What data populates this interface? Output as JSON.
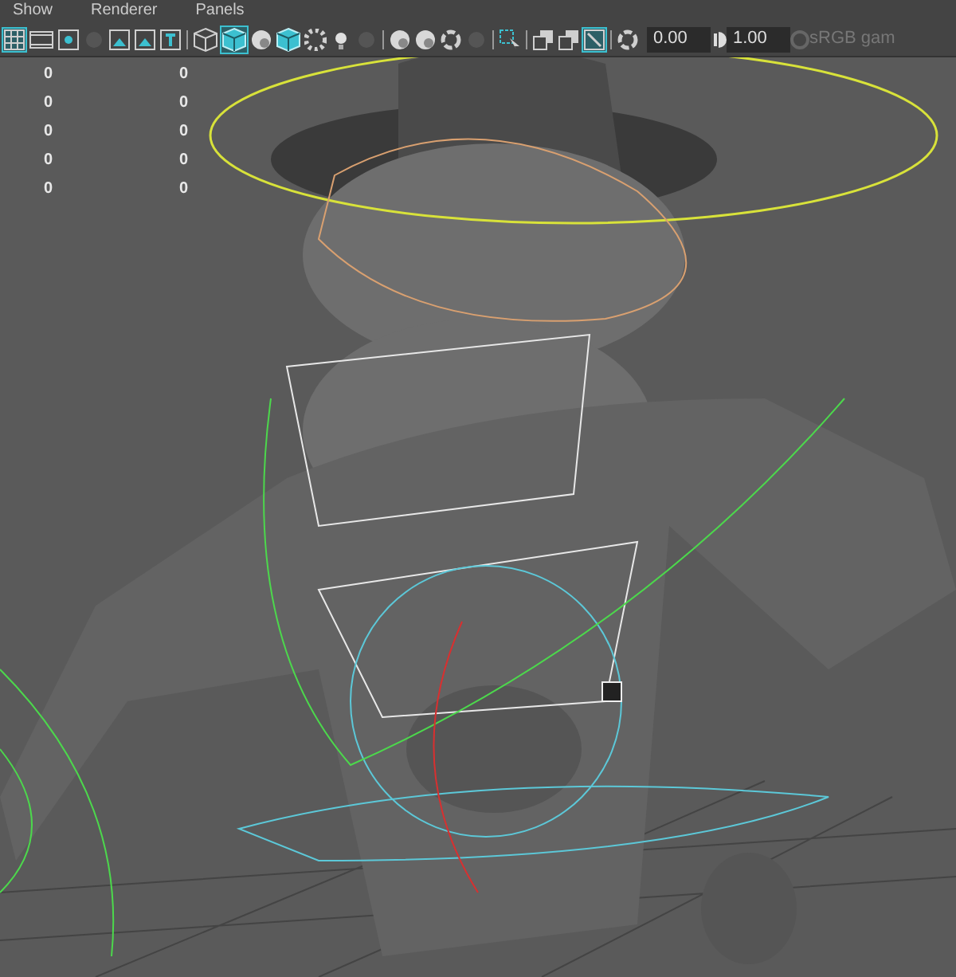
{
  "menu_bar": [
    "Show",
    "Renderer",
    "Panels"
  ],
  "toolbar": {
    "items": [
      {
        "kind": "grid",
        "selected": true
      },
      {
        "kind": "film",
        "selected": false
      },
      {
        "kind": "dot",
        "selected": false
      },
      {
        "kind": "dim",
        "selected": false
      },
      {
        "kind": "image",
        "selected": false
      },
      {
        "kind": "image",
        "selected": false
      },
      {
        "kind": "text",
        "selected": false
      },
      {
        "kind": "sep",
        "selected": false
      },
      {
        "kind": "wire",
        "selected": false
      },
      {
        "kind": "shaded",
        "selected": true
      },
      {
        "kind": "sphere",
        "selected": false
      },
      {
        "kind": "shaded",
        "selected": false
      },
      {
        "kind": "checker",
        "selected": false
      },
      {
        "kind": "light",
        "selected": false
      },
      {
        "kind": "dim",
        "selected": false
      },
      {
        "kind": "sep",
        "selected": false
      },
      {
        "kind": "sphere",
        "selected": false
      },
      {
        "kind": "sphere",
        "selected": false
      },
      {
        "kind": "ring",
        "selected": false
      },
      {
        "kind": "dim",
        "selected": false
      },
      {
        "kind": "sep",
        "selected": false
      },
      {
        "kind": "select",
        "selected": false
      },
      {
        "kind": "sep",
        "selected": false
      },
      {
        "kind": "squares",
        "selected": false
      },
      {
        "kind": "squares",
        "selected": false
      },
      {
        "kind": "frame",
        "selected": true
      },
      {
        "kind": "sep",
        "selected": false
      },
      {
        "kind": "ring",
        "selected": false
      }
    ],
    "exposure": "0.00",
    "gamma": "1.00",
    "color_space": "sRGB gam"
  },
  "hud_rows": [
    [
      "0",
      "0"
    ],
    [
      "0",
      "0"
    ],
    [
      "0",
      "0"
    ],
    [
      "0",
      "0"
    ],
    [
      "0",
      "0"
    ]
  ]
}
